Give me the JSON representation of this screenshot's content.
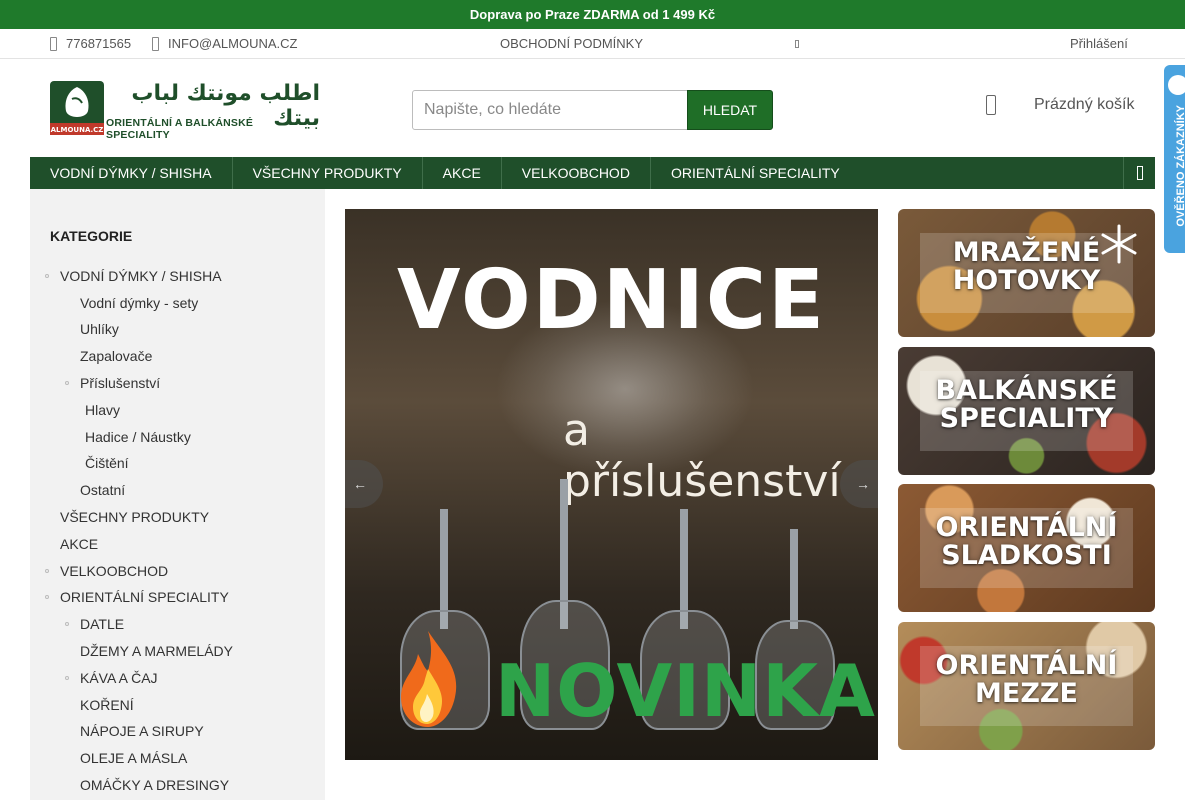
{
  "promo": {
    "text": "Doprava po Praze ZDARMA od 1 499 Kč"
  },
  "topbar": {
    "phone": "776871565",
    "email": "INFO@ALMOUNA.CZ",
    "terms": "OBCHODNÍ PODMÍNKY",
    "login": "Přihlášení"
  },
  "logo": {
    "arabic": "اطلب مونتك لباب بيتك",
    "tagline": "ORIENTÁLNÍ A BALKÁNSKÉ SPECIALITY",
    "badge_text": "ALMOUNA.CZ"
  },
  "search": {
    "placeholder": "Napište, co hledáte",
    "button": "HLEDAT"
  },
  "cart": {
    "label": "Prázdný košík"
  },
  "nav": {
    "items": [
      {
        "label": "VODNÍ DÝMKY / SHISHA"
      },
      {
        "label": "VŠECHNY PRODUKTY"
      },
      {
        "label": "AKCE"
      },
      {
        "label": "VELKOOBCHOD"
      },
      {
        "label": "ORIENTÁLNÍ SPECIALITY"
      }
    ]
  },
  "side_tab": {
    "label": "OVĚŘENO ZÁKAZNÍKY"
  },
  "sidebar": {
    "title": "KATEGORIE",
    "items": [
      {
        "label": "VODNÍ DÝMKY / SHISHA"
      },
      {
        "label": "Vodní dýmky - sety"
      },
      {
        "label": "Uhlíky"
      },
      {
        "label": "Zapalovače"
      },
      {
        "label": "Příslušenství"
      },
      {
        "label": "Hlavy"
      },
      {
        "label": "Hadice / Náustky"
      },
      {
        "label": "Čištění"
      },
      {
        "label": "Ostatní"
      },
      {
        "label": "VŠECHNY PRODUKTY"
      },
      {
        "label": "AKCE"
      },
      {
        "label": "VELKOOBCHOD"
      },
      {
        "label": "ORIENTÁLNÍ SPECIALITY"
      },
      {
        "label": "DATLE"
      },
      {
        "label": "DŽEMY A MARMELÁDY"
      },
      {
        "label": "KÁVA A ČAJ"
      },
      {
        "label": "KOŘENÍ"
      },
      {
        "label": "NÁPOJE A SIRUPY"
      },
      {
        "label": "OLEJE A MÁSLA"
      },
      {
        "label": "OMÁČKY A DRESINGY"
      }
    ]
  },
  "banner": {
    "title": "VODNICE",
    "subtitle": "a příslušenství",
    "badge": "NOVINKA",
    "prev_arrow": "←",
    "next_arrow": "→"
  },
  "tiles": [
    {
      "label": "MRAŽENÉ HOTOVKY"
    },
    {
      "label": "BALKÁNSKÉ SPECIALITY"
    },
    {
      "label": "ORIENTÁLNÍ SLADKOSTI"
    },
    {
      "label": "ORIENTÁLNÍ MEZZE"
    }
  ],
  "colors": {
    "brand_green": "#1f7a2b",
    "nav_green": "#1f4f2a",
    "accent_green": "#2ea34a"
  }
}
